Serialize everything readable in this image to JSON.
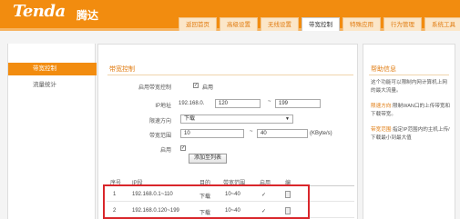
{
  "header": {
    "logo": "Tenda",
    "logo_cn": "腾达",
    "tabs": [
      "返回首页",
      "高级设置",
      "无线设置",
      "带宽控制",
      "特殊应用",
      "行为管理",
      "系统工具"
    ],
    "active_tab_index": 3
  },
  "sidebar": {
    "items": [
      {
        "label": "带宽控制",
        "active": true
      },
      {
        "label": "流量统计",
        "active": false
      }
    ]
  },
  "main": {
    "section_title": "带宽控制",
    "enable_row": {
      "label": "启用带宽控制",
      "checked": true,
      "option": "启用"
    },
    "ip_row": {
      "label": "IP地址",
      "prefix": "192.168.0.",
      "start": "120",
      "separator": "~",
      "end": "199"
    },
    "direction_row": {
      "label": "限速方向",
      "value": "下载"
    },
    "bandwidth_row": {
      "label": "带宽范围",
      "min": "10",
      "separator": "~",
      "max": "40",
      "unit": "(KByte/s)"
    },
    "enable2_row": {
      "label": "启用",
      "checked": true
    },
    "add_button": "添加至列表",
    "table": {
      "headers": [
        "序号",
        "IP段",
        "目的",
        "带宽范围",
        "启用",
        "编"
      ],
      "rows": [
        {
          "no": "1",
          "ip": "192.168.0.1~110",
          "dir": "下载",
          "range": "10~40",
          "enabled": "✓"
        },
        {
          "no": "2",
          "ip": "192.168.0.120~199",
          "dir": "下载",
          "range": "10~40",
          "enabled": "✓"
        }
      ]
    }
  },
  "help": {
    "title": "帮助信息",
    "intro": "这个功能可以限制内网计算机上网的最大流量。",
    "dir_label": "限速方向:",
    "dir_text": "限制WAN口的上传带宽和下载带宽。",
    "range_label": "带宽范围:",
    "range_text": "指定IP范围内的主机上传/下载最小到最大值"
  },
  "colors": {
    "brand": "#f28c0f",
    "highlight": "#d9262b"
  }
}
